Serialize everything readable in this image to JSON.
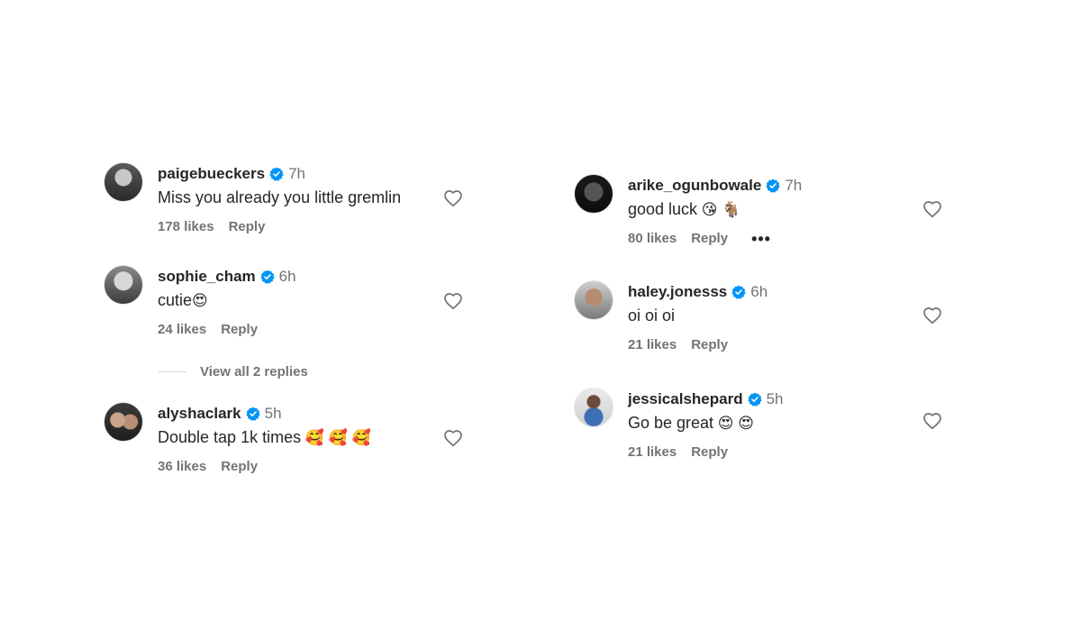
{
  "left_comments": [
    {
      "username": "paigebueckers",
      "time": "7h",
      "text": "Miss you already you little gremlin",
      "emoji": "",
      "likes": "178 likes",
      "reply": "Reply"
    },
    {
      "username": "sophie_cham",
      "time": "6h",
      "text": "cutie",
      "emoji": "😍",
      "likes": "24 likes",
      "reply": "Reply"
    },
    {
      "username": "alyshaclark",
      "time": "5h",
      "text": "Double tap 1k times",
      "emoji": " 🥰 🥰 🥰",
      "likes": "36 likes",
      "reply": "Reply"
    }
  ],
  "view_replies": "View all 2 replies",
  "right_comments": [
    {
      "username": "arike_ogunbowale",
      "time": "7h",
      "text": "good luck",
      "emoji": " 😘 🐐",
      "likes": "80 likes",
      "reply": "Reply",
      "more": "•••"
    },
    {
      "username": "haley.jonesss",
      "time": "6h",
      "text": "oi oi oi",
      "emoji": "",
      "likes": "21 likes",
      "reply": "Reply"
    },
    {
      "username": "jessicalshepard",
      "time": "5h",
      "text": "Go be great",
      "emoji": " 😍 😍",
      "likes": "21 likes",
      "reply": "Reply"
    }
  ],
  "icons": {
    "verified": "verified-badge-icon",
    "like": "heart-outline-icon",
    "avatar": "profile-picture"
  },
  "colors": {
    "verified": "#0095f6",
    "text": "#262626",
    "secondary": "#737373"
  }
}
